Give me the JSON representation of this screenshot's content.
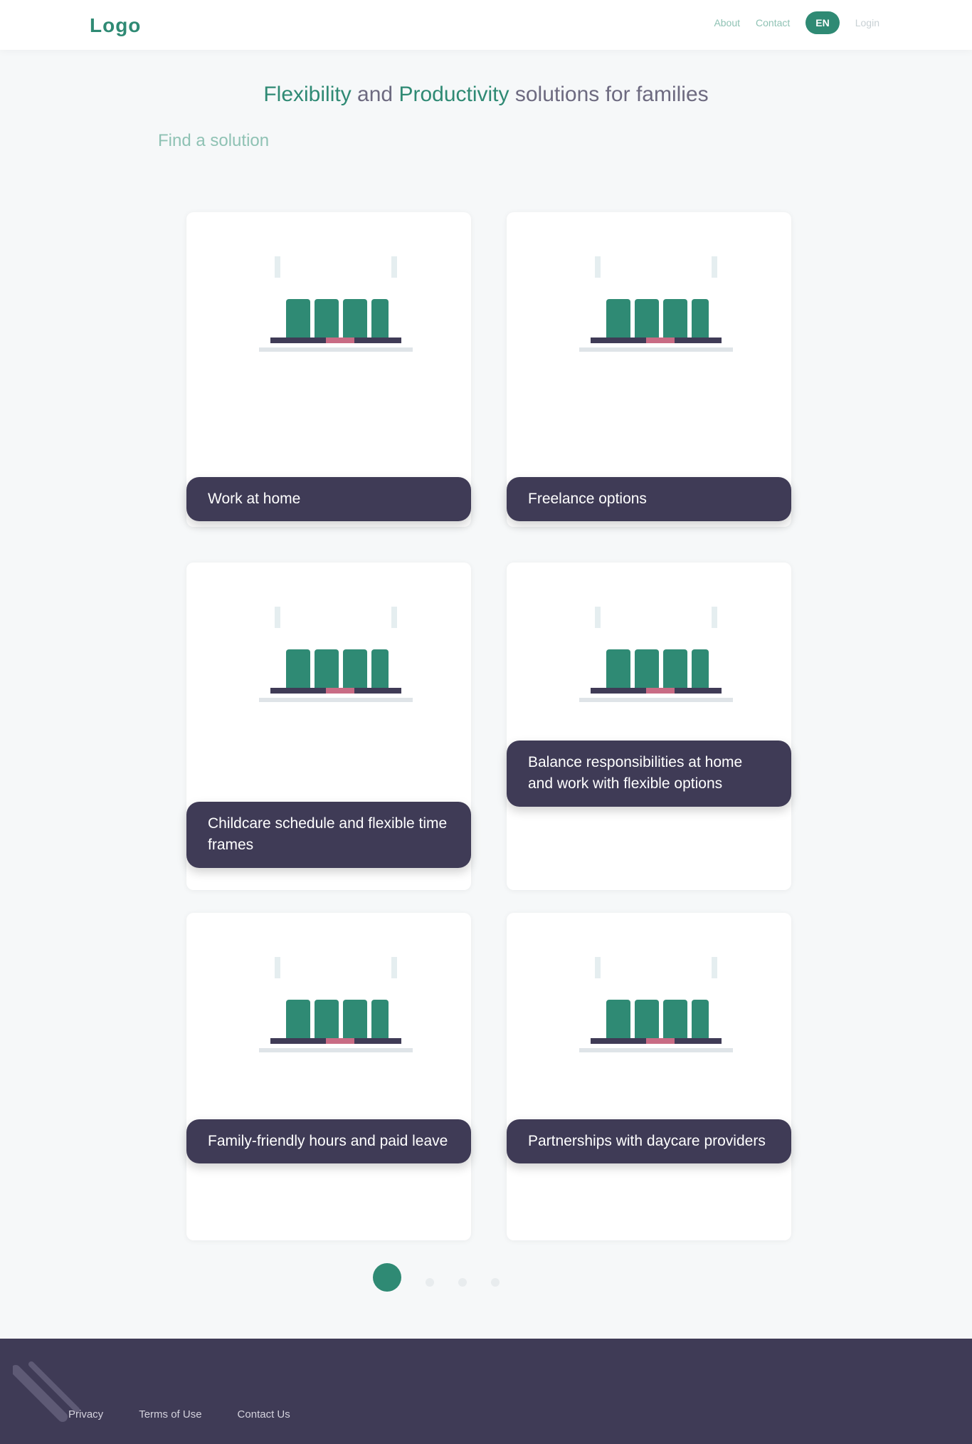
{
  "header": {
    "logo": "Logo",
    "nav": [
      "About",
      "Contact"
    ],
    "lang": "EN",
    "login": "Login"
  },
  "subtitle": {
    "part1": "Flexibility",
    "part2": "and",
    "part3": "Productivity",
    "part4": "solutions for families"
  },
  "section_label": "Find a solution",
  "cards": [
    {
      "caption": "Work at home"
    },
    {
      "caption": "Freelance options"
    },
    {
      "caption": "Childcare schedule and flexible time frames"
    },
    {
      "caption": "Balance responsibilities at home and work with flexible options"
    },
    {
      "caption": "Family-friendly hours and paid leave"
    },
    {
      "caption": "Partnerships with daycare providers"
    }
  ],
  "pagination": {
    "total": 4,
    "active": 1
  },
  "footer": {
    "links": [
      "Privacy",
      "Terms of Use",
      "Contact Us"
    ]
  },
  "colors": {
    "brand": "#2f8a74",
    "dark": "#3f3b56",
    "bg": "#f6f8f9"
  }
}
